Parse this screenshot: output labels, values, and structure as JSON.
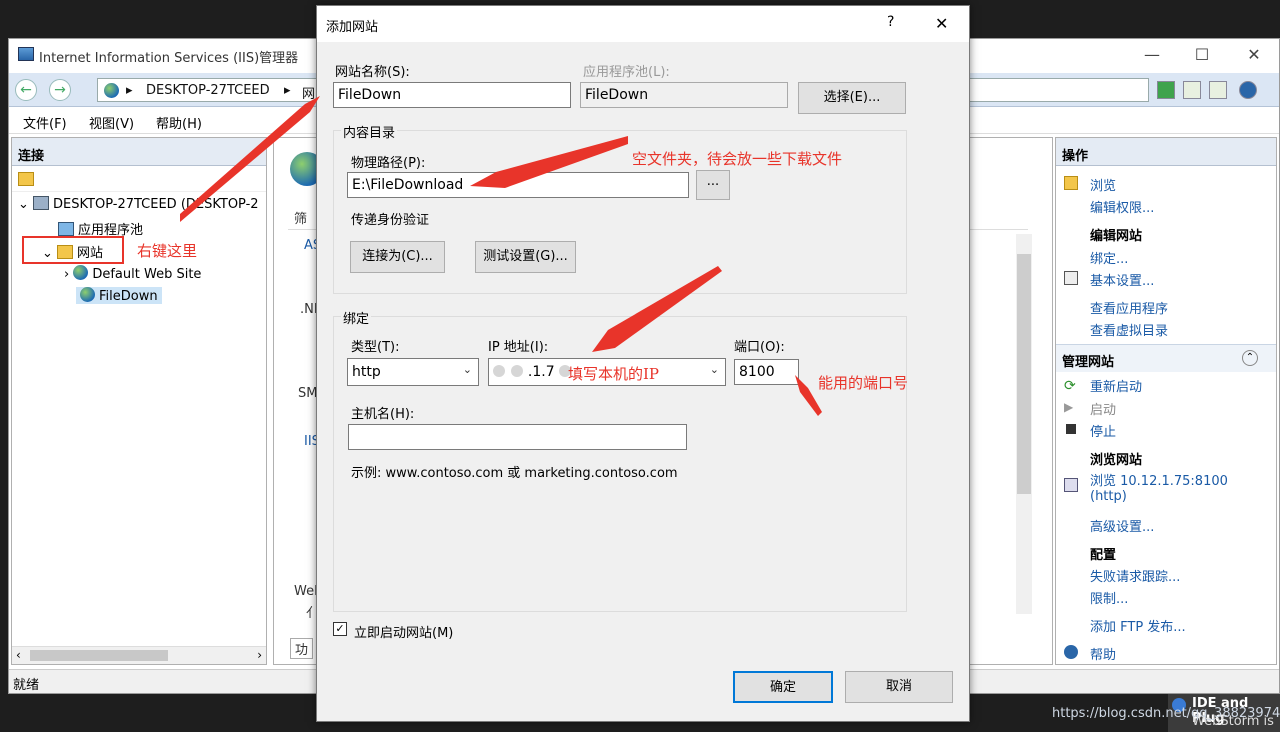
{
  "iis": {
    "title": "Internet Information Services (IIS)管理器",
    "breadcrumb": [
      "DESKTOP-27TCEED",
      "网"
    ],
    "menu": [
      "文件(F)",
      "视图(V)",
      "帮助(H)"
    ],
    "connections": {
      "header": "连接",
      "tree": {
        "server": "DESKTOP-27TCEED (DESKTOP-2",
        "app_pools": "应用程序池",
        "sites": "网站",
        "default_site": "Default Web Site",
        "filedown": "FileDown"
      }
    },
    "center_fragments": [
      "筛",
      "AS",
      ".NI",
      "SM",
      "IIS",
      "Wel",
      "亻",
      "功"
    ],
    "actions": {
      "header": "操作",
      "browse": "浏览",
      "edit_perms": "编辑权限...",
      "edit_site_h": "编辑网站",
      "bindings": "绑定...",
      "basic_settings": "基本设置...",
      "view_apps": "查看应用程序",
      "view_vdirs": "查看虚拟目录",
      "manage_site": "管理网站",
      "restart": "重新启动",
      "start": "启动",
      "stop": "停止",
      "browse_site_h": "浏览网站",
      "browse_url": "浏览 10.12.1.75:8100",
      "browse_proto": "(http)",
      "advanced": "高级设置...",
      "config_h": "配置",
      "failed_req": "失败请求跟踪...",
      "limits": "限制...",
      "add_ftp": "添加 FTP 发布...",
      "help": "帮助"
    },
    "status": "就绪"
  },
  "dialog": {
    "title": "添加网站",
    "help_glyph": "?",
    "close_glyph": "✕",
    "site_name_label": "网站名称(S):",
    "site_name_value": "FileDown",
    "app_pool_label": "应用程序池(L):",
    "app_pool_value": "FileDown",
    "select_button": "选择(E)...",
    "content_dir_group": "内容目录",
    "physical_path_label": "物理路径(P):",
    "physical_path_value": "E:\\FileDownload",
    "browse_button": "...",
    "passthrough_label": "传递身份验证",
    "connect_as_button": "连接为(C)...",
    "test_settings_button": "测试设置(G)...",
    "binding_group": "绑定",
    "type_label": "类型(T):",
    "type_value": "http",
    "ip_label": "IP 地址(I):",
    "ip_value": ".1.7",
    "port_label": "端口(O):",
    "port_value": "8100",
    "hostname_label": "主机名(H):",
    "hostname_value": "",
    "example_text": "示例: www.contoso.com 或 marketing.contoso.com",
    "start_now_label": "立即启动网站(M)",
    "start_now_checked": true,
    "ok_button": "确定",
    "cancel_button": "取消"
  },
  "annotations": {
    "right_click_here": "右键这里",
    "empty_folder": "空文件夹，待会放一些下载文件",
    "fill_ip": "填写本机的IP",
    "usable_port": "能用的端口号",
    "color": "#e8342a"
  },
  "overlay": {
    "tray_line1": "IDE and Plug",
    "tray_line2": "WebStorm is",
    "watermark": "https://blog.csdn.net/qq_38823974"
  }
}
